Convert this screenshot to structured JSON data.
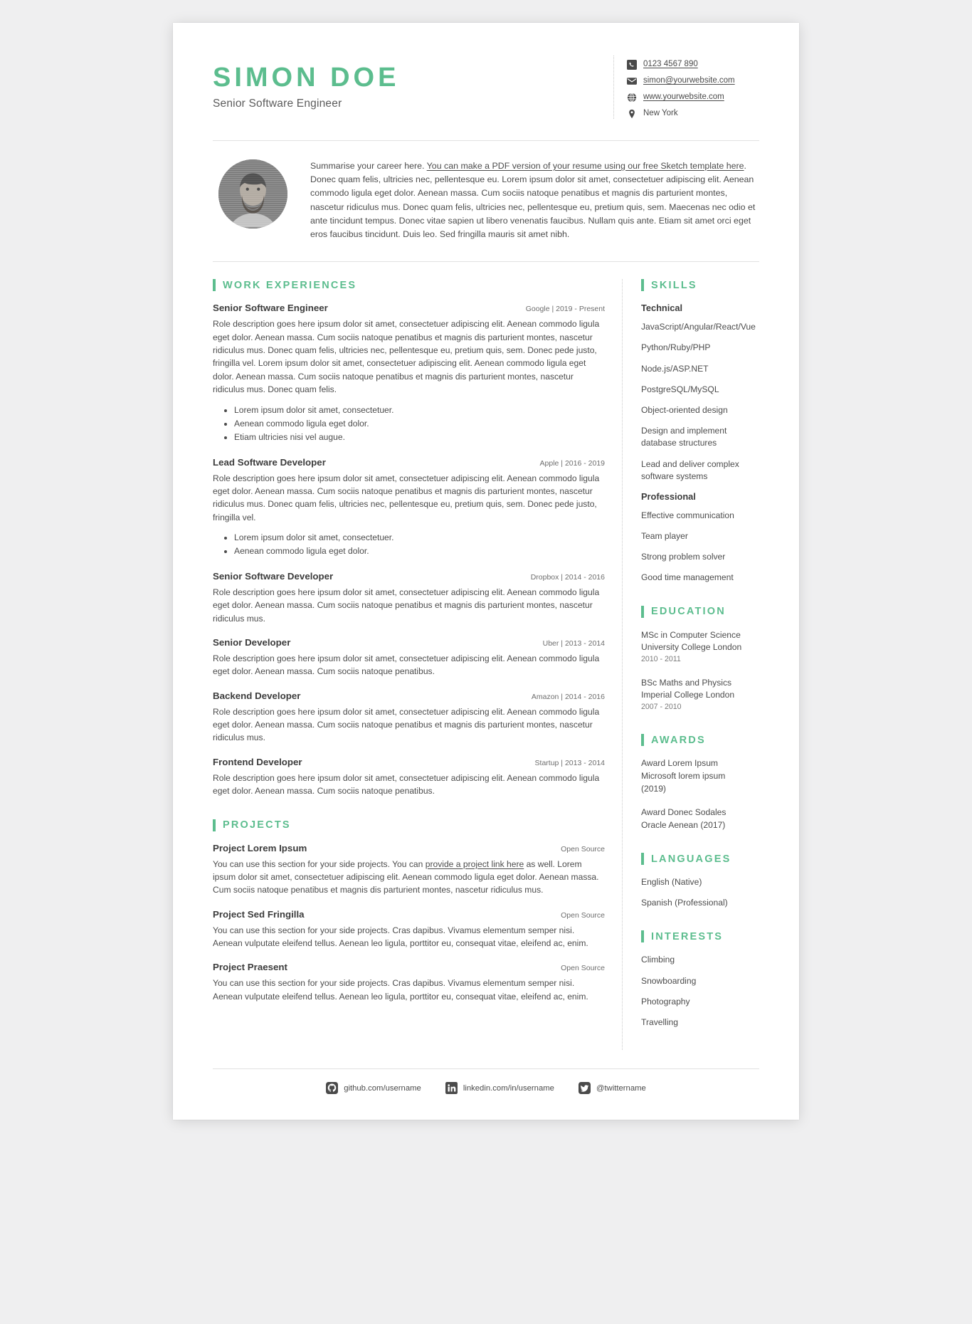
{
  "header": {
    "name": "SIMON DOE",
    "job_title": "Senior Software Engineer",
    "contacts": [
      {
        "icon": "phone-icon",
        "text": "0123 4567 890",
        "link": true
      },
      {
        "icon": "envelope-icon",
        "text": "simon@yourwebsite.com",
        "link": true
      },
      {
        "icon": "globe-icon",
        "text": "www.yourwebsite.com",
        "link": true
      },
      {
        "icon": "location-pin-icon",
        "text": "New York",
        "link": false
      }
    ]
  },
  "summary": {
    "avatar_alt": "profile-photo",
    "part1": "Summarise your career here. ",
    "link_text": "You can make a PDF version of your resume using our free Sketch template here",
    "part2": ". Donec quam felis, ultricies nec, pellentesque eu. Lorem ipsum dolor sit amet, consectetuer adipiscing elit. Aenean commodo ligula eget dolor. Aenean massa. Cum sociis natoque penatibus et magnis dis parturient montes, nascetur ridiculus mus. Donec quam felis, ultricies nec, pellentesque eu, pretium quis, sem. Maecenas nec odio et ante tincidunt tempus. Donec vitae sapien ut libero venenatis faucibus. Nullam quis ante. Etiam sit amet orci eget eros faucibus tincidunt. Duis leo. Sed fringilla mauris sit amet nibh."
  },
  "work": {
    "section_title": "WORK EXPERIENCES",
    "entries": [
      {
        "title": "Senior Software Engineer",
        "meta": "Google | 2019 - Present",
        "description": "Role description goes here ipsum dolor sit amet, consectetuer adipiscing elit. Aenean commodo ligula eget dolor. Aenean massa. Cum sociis natoque penatibus et magnis dis parturient montes, nascetur ridiculus mus. Donec quam felis, ultricies nec, pellentesque eu, pretium quis, sem. Donec pede justo, fringilla vel. Lorem ipsum dolor sit amet, consectetuer adipiscing elit. Aenean commodo ligula eget dolor. Aenean massa. Cum sociis natoque penatibus et magnis dis parturient montes, nascetur ridiculus mus. Donec quam felis.",
        "bullets": [
          "Lorem ipsum dolor sit amet, consectetuer.",
          "Aenean commodo ligula eget dolor.",
          "Etiam ultricies nisi vel augue."
        ]
      },
      {
        "title": "Lead Software Developer",
        "meta": "Apple | 2016 - 2019",
        "description": "Role description goes here ipsum dolor sit amet, consectetuer adipiscing elit. Aenean commodo ligula eget dolor. Aenean massa. Cum sociis natoque penatibus et magnis dis parturient montes, nascetur ridiculus mus. Donec quam felis, ultricies nec, pellentesque eu, pretium quis, sem. Donec pede justo, fringilla vel.",
        "bullets": [
          "Lorem ipsum dolor sit amet, consectetuer.",
          "Aenean commodo ligula eget dolor."
        ]
      },
      {
        "title": "Senior Software Developer",
        "meta": "Dropbox | 2014 - 2016",
        "description": "Role description goes here ipsum dolor sit amet, consectetuer adipiscing elit. Aenean commodo ligula eget dolor. Aenean massa. Cum sociis natoque penatibus et magnis dis parturient montes, nascetur ridiculus mus.",
        "bullets": []
      },
      {
        "title": "Senior Developer",
        "meta": "Uber | 2013 - 2014",
        "description": "Role description goes here ipsum dolor sit amet, consectetuer adipiscing elit. Aenean commodo ligula eget dolor. Aenean massa. Cum sociis natoque penatibus.",
        "bullets": []
      },
      {
        "title": "Backend Developer",
        "meta": "Amazon | 2014 - 2016",
        "description": "Role description goes here ipsum dolor sit amet, consectetuer adipiscing elit. Aenean commodo ligula eget dolor. Aenean massa. Cum sociis natoque penatibus et magnis dis parturient montes, nascetur ridiculus mus.",
        "bullets": []
      },
      {
        "title": "Frontend Developer",
        "meta": "Startup | 2013 - 2014",
        "description": "Role description goes here ipsum dolor sit amet, consectetuer adipiscing elit. Aenean commodo ligula eget dolor. Aenean massa. Cum sociis natoque penatibus.",
        "bullets": []
      }
    ]
  },
  "projects": {
    "section_title": "PROJECTS",
    "entries": [
      {
        "title": "Project Lorem Ipsum",
        "meta": "Open Source",
        "desc_part1": "You can use this section for your side projects. You can ",
        "desc_link": "provide a project link here",
        "desc_part2": " as well. Lorem ipsum dolor sit amet, consectetuer adipiscing elit. Aenean commodo ligula eget dolor. Aenean massa. Cum sociis natoque penatibus et magnis dis parturient montes, nascetur ridiculus mus."
      },
      {
        "title": "Project Sed Fringilla",
        "meta": "Open Source",
        "desc_part1": "You can use this section for your side projects. Cras dapibus. Vivamus elementum semper nisi. Aenean vulputate eleifend tellus. Aenean leo ligula, porttitor eu, consequat vitae, eleifend ac, enim.",
        "desc_link": "",
        "desc_part2": ""
      },
      {
        "title": "Project Praesent",
        "meta": "Open Source",
        "desc_part1": "You can use this section for your side projects. Cras dapibus. Vivamus elementum semper nisi. Aenean vulputate eleifend tellus. Aenean leo ligula, porttitor eu, consequat vitae, eleifend ac, enim.",
        "desc_link": "",
        "desc_part2": ""
      }
    ]
  },
  "skills": {
    "section_title": "SKILLS",
    "technical_label": "Technical",
    "technical": [
      "JavaScript/Angular/React/Vue",
      "Python/Ruby/PHP",
      "Node.js/ASP.NET",
      "PostgreSQL/MySQL",
      "Object-oriented design",
      "Design and implement database structures",
      "Lead and deliver complex software systems"
    ],
    "professional_label": "Professional",
    "professional": [
      "Effective communication",
      "Team player",
      "Strong problem solver",
      "Good time management"
    ]
  },
  "education": {
    "section_title": "EDUCATION",
    "entries": [
      {
        "degree": "MSc in Computer Science",
        "school": "University College London",
        "dates": "2010 - 2011"
      },
      {
        "degree": "BSc Maths and Physics",
        "school": "Imperial College London",
        "dates": "2007 - 2010"
      }
    ]
  },
  "awards": {
    "section_title": "AWARDS",
    "entries": [
      {
        "line1": "Award Lorem Ipsum",
        "line2": "Microsoft lorem ipsum",
        "line3": "(2019)"
      },
      {
        "line1": "Award Donec Sodales",
        "line2": "Oracle Aenean (2017)",
        "line3": ""
      }
    ]
  },
  "languages": {
    "section_title": "LANGUAGES",
    "items": [
      "English (Native)",
      "Spanish (Professional)"
    ]
  },
  "interests": {
    "section_title": "INTERESTS",
    "items": [
      "Climbing",
      "Snowboarding",
      "Photography",
      "Travelling"
    ]
  },
  "footer": {
    "links": [
      {
        "icon": "github-icon",
        "text": "github.com/username"
      },
      {
        "icon": "linkedin-icon",
        "text": "linkedin.com/in/username"
      },
      {
        "icon": "twitter-icon",
        "text": "@twittername"
      }
    ]
  },
  "colors": {
    "accent": "#5cbd8e",
    "text": "#4c4c4c",
    "heading": "#3c3c3c"
  }
}
